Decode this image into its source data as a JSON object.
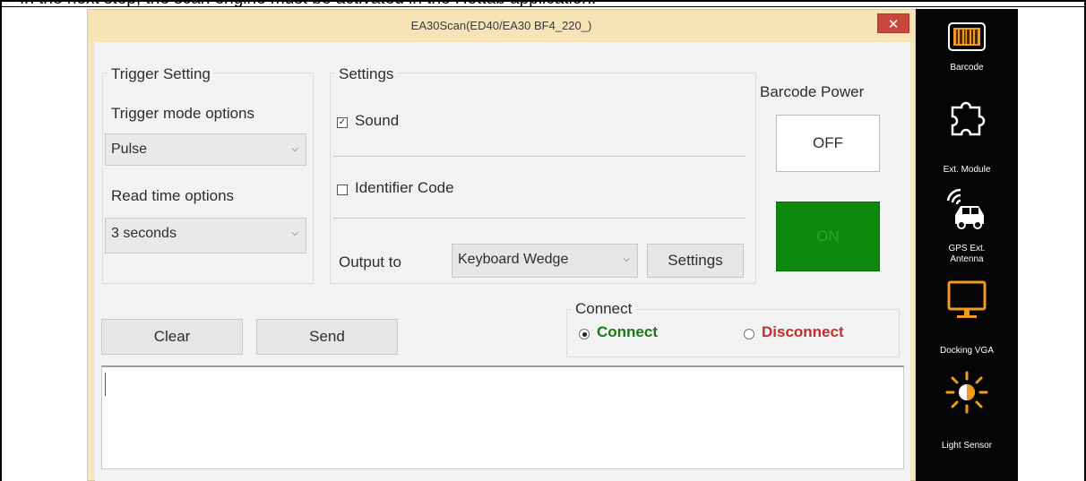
{
  "caption": "In the next step, the scan engine must be activated in the Hottab application.",
  "window": {
    "title": "EA30Scan(ED40/EA30 BF4_220_)",
    "close_glyph": "✕"
  },
  "trigger": {
    "group_title": "Trigger Setting",
    "mode_label": "Trigger mode options",
    "mode_value": "Pulse",
    "read_label": "Read time options",
    "read_value": "3 seconds"
  },
  "settings": {
    "group_title": "Settings",
    "sound_label": "Sound",
    "sound_checked": true,
    "identifier_label": "Identifier Code",
    "identifier_checked": false,
    "output_label": "Output to",
    "output_value": "Keyboard Wedge",
    "settings_button": "Settings"
  },
  "power": {
    "title": "Barcode Power",
    "off_label": "OFF",
    "on_label": "ON",
    "on_color": "#0d8a0d"
  },
  "actions": {
    "clear": "Clear",
    "send": "Send"
  },
  "connect": {
    "group_title": "Connect",
    "connect_label": "Connect",
    "disconnect_label": "Disconnect",
    "selected": "Connect",
    "connect_color": "#1a7a1a",
    "disconnect_color": "#c0302b"
  },
  "dock": {
    "items": [
      {
        "label": "Barcode",
        "icon": "barcode-icon"
      },
      {
        "label": "Ext. Module",
        "icon": "puzzle-icon"
      },
      {
        "label": "GPS Ext. Antenna",
        "icon": "car-signal-icon"
      },
      {
        "label": "Docking VGA",
        "icon": "monitor-icon"
      },
      {
        "label": "Light Sensor",
        "icon": "sun-icon"
      }
    ],
    "accent": "#f39a1e"
  }
}
